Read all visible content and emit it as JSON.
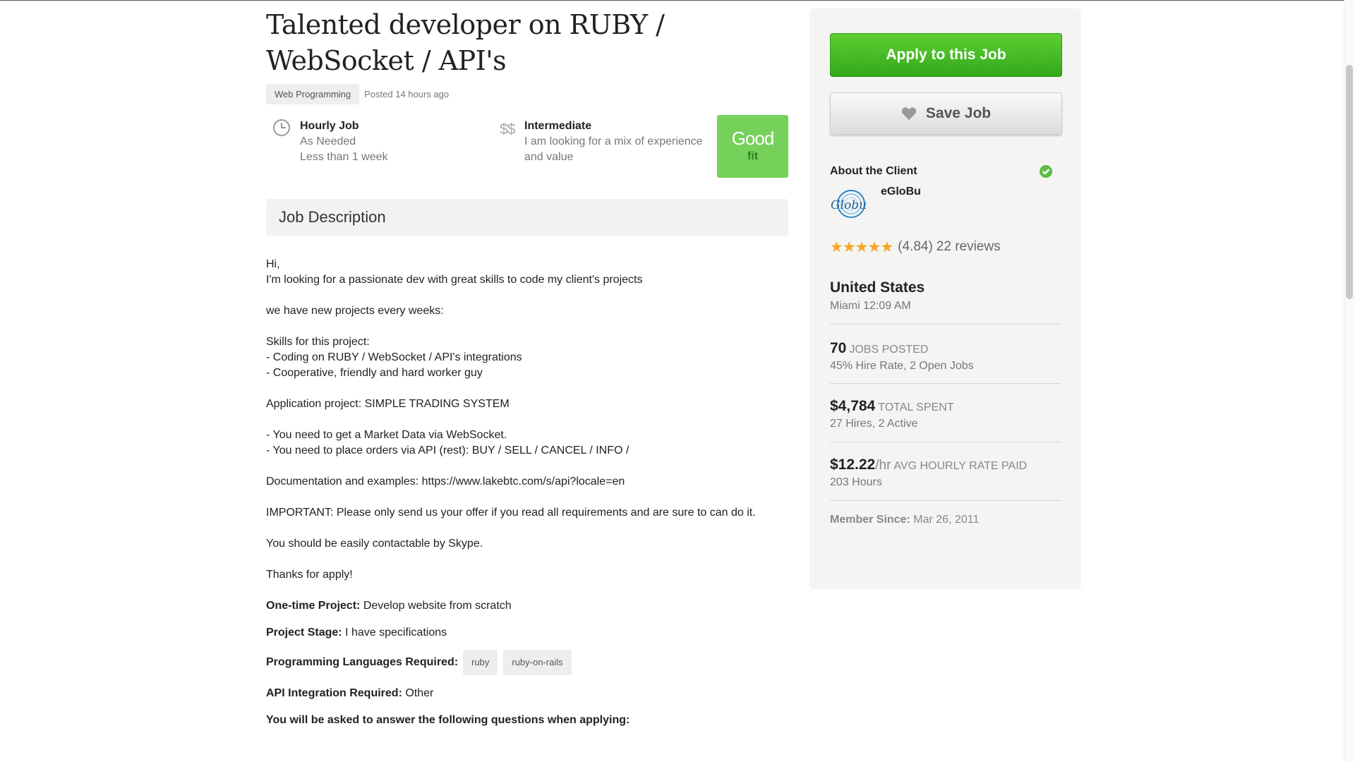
{
  "job": {
    "title": "Talented developer on RUBY / WebSocket / API's",
    "category": "Web Programming",
    "posted": "Posted 14 hours ago",
    "hourly": {
      "head": "Hourly Job",
      "line1": "As Needed",
      "line2": "Less than 1 week"
    },
    "level": {
      "icon": "$$",
      "head": "Intermediate",
      "line1": "I am looking for a mix of experience",
      "line2": "and value"
    },
    "fit": {
      "line1": "Good",
      "line2": "fit"
    }
  },
  "description": {
    "header": "Job Description",
    "lines": [
      "Hi,",
      "I'm looking for a passionate dev with great skills to code my client's projects",
      "",
      "we have new projects every weeks:",
      "",
      "Skills for this project:",
      "- Coding on RUBY / WebSocket / API's integrations",
      "- Cooperative, friendly and hard worker guy",
      "",
      "Application project: SIMPLE TRADING SYSTEM",
      "",
      "- You need to get a Market Data via WebSocket.",
      "- You need to place orders via API (rest): BUY / SELL / CANCEL / INFO /",
      "",
      "Documentation and examples: https://www.lakebtc.com/s/api?locale=en",
      "",
      "IMPORTANT: Please only send us your offer if you read all requirements and are sure to can do it.",
      "",
      "You should be easily contactable by Skype.",
      "",
      "Thanks for apply!"
    ],
    "one_time_label": "One-time Project:",
    "one_time_value": "Develop website from scratch",
    "stage_label": "Project Stage:",
    "stage_value": "I have specifications",
    "langs_label": "Programming Languages Required:",
    "langs": [
      "ruby",
      "ruby-on-rails"
    ],
    "api_label": "API Integration Required:",
    "api_value": "Other",
    "questions": "You will be asked to answer the following questions when applying:"
  },
  "sidebar": {
    "apply_label": "Apply to this Job",
    "save_label": "Save Job",
    "about_label": "About the Client",
    "client_name": "eGloBu",
    "logo_text": "Globu",
    "stars": 5,
    "rating": "(4.84)",
    "reviews": "22 reviews",
    "country": "United States",
    "local_time": "Miami 12:09 AM",
    "jobs_posted": {
      "value": "70",
      "label": "JOBS POSTED",
      "sub": "45% Hire Rate, 2 Open Jobs"
    },
    "total_spent": {
      "value": "$4,784",
      "label": "TOTAL SPENT",
      "sub": "27 Hires, 2 Active"
    },
    "avg_rate": {
      "value": "$12.22",
      "unit": "/hr",
      "label": "AVG HOURLY RATE PAID",
      "sub": "203 Hours"
    },
    "member_label": "Member Since:",
    "member_value": "Mar 26, 2011"
  },
  "colors": {
    "apply": "#34a81b",
    "fit": "#76d15b",
    "star": "#f5a623",
    "check": "#5cbd44"
  }
}
